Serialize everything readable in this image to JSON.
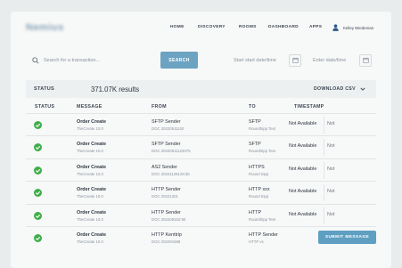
{
  "header": {
    "brand": "Nemius",
    "nav": [
      "HOME",
      "DISCOVERY",
      "ROOMS",
      "DASHBOARD",
      "APPS"
    ],
    "user_name": "Kelley Wiedeman"
  },
  "search": {
    "placeholder": "Search for a transaction...",
    "button_label": "SEARCH",
    "start_date_placeholder": "Start start date/time",
    "end_date_placeholder": "Enter date/time"
  },
  "status_bar": {
    "label": "STATUS",
    "results": "371.07K results",
    "download_label": "DOWNLOAD CSV"
  },
  "table": {
    "headers": [
      "STATUS",
      "MESSAGE",
      "FROM",
      "TO",
      "TIMESTAMP"
    ],
    "rows": [
      {
        "message": "Order Create",
        "message_sub": "TheCreate 10.0",
        "from": "SFTP Sender",
        "from_sub": "DOC 20220511100",
        "to": "SFTP",
        "to_sub": "Roundtripp Test",
        "timestamp": "Not Available",
        "extra": "Not"
      },
      {
        "message": "Order Create",
        "message_sub": "TheCreate 10.0",
        "from": "SFTP Sender",
        "from_sub": "DOC 20220511122075",
        "to": "SFTP",
        "to_sub": "Roundtripp Test",
        "timestamp": "Not Available",
        "extra": "Not"
      },
      {
        "message": "Order Create",
        "message_sub": "TheCreate 10.0",
        "from": "AS2 Sender",
        "from_sub": "DOC 20221128128:35",
        "to": "HTTPS",
        "to_sub": "Round tripp",
        "timestamp": "Not Available",
        "extra": "Not"
      },
      {
        "message": "Order Create",
        "message_sub": "TheCreate 10.0",
        "from": "HTTP Sender",
        "from_sub": "DOC 20221201",
        "to": "HTTP xxx",
        "to_sub": "Round tripp",
        "timestamp": "Not Available",
        "extra": "Not"
      },
      {
        "message": "Order Create",
        "message_sub": "TheCreate 10.0",
        "from": "HTTP Sender",
        "from_sub": "DOC 202209152:90",
        "to": "HTTP",
        "to_sub": "Roundtripp Test",
        "timestamp": "Not Available",
        "extra": "Not"
      },
      {
        "message": "Order Create",
        "message_sub": "TheCreate 10.0",
        "from": "HTTP Kenttrip",
        "from_sub": "DOC 202291588",
        "to": "HTTP Sender",
        "to_sub": "HTTP vs",
        "timestamp": "",
        "extra": ""
      }
    ],
    "submit_label": "SUBMIT MESSAGE"
  },
  "colors": {
    "accent": "#6ca3c2",
    "success": "#3fae49",
    "user_icon": "#2a5a8f"
  },
  "icons": {
    "search": "search-icon",
    "calendar": "calendar-icon",
    "user": "user-icon",
    "status_ok": "check-circle-icon",
    "dropdown": "chevron-down-icon"
  }
}
